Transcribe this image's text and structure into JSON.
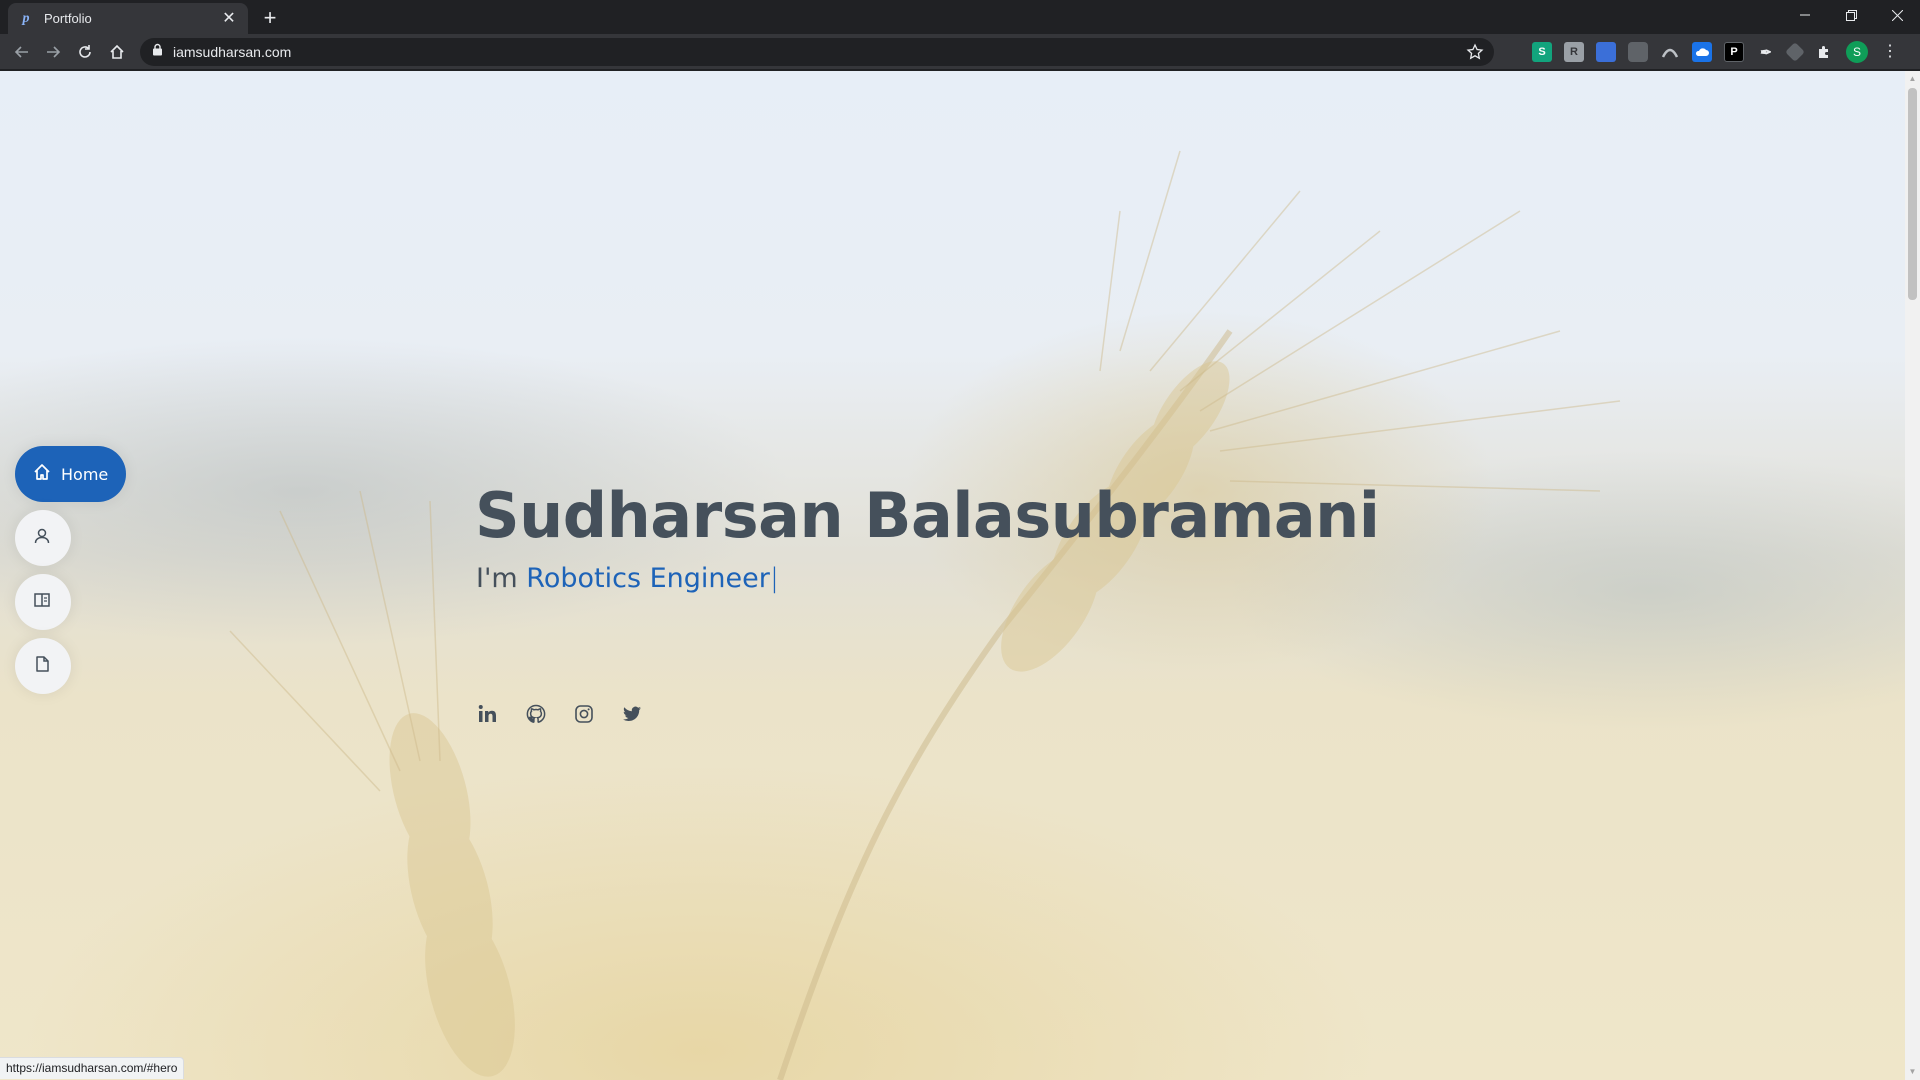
{
  "browser": {
    "tab_title": "Portfolio",
    "tab_favicon": "p",
    "url": "iamsudharsan.com",
    "status_url": "https://iamsudharsan.com/#hero",
    "profile_initial": "S",
    "extensions": [
      "S",
      "R",
      "",
      "",
      "",
      "",
      "P",
      "",
      ""
    ]
  },
  "nav": {
    "items": [
      {
        "name": "home",
        "label": "Home",
        "icon": "home-icon",
        "active": true
      },
      {
        "name": "about",
        "label": "",
        "icon": "person-icon"
      },
      {
        "name": "resume",
        "label": "",
        "icon": "book-icon"
      },
      {
        "name": "portfolio",
        "label": "",
        "icon": "file-icon"
      }
    ]
  },
  "hero": {
    "name": "Sudharsan Balasubramani",
    "prefix": "I'm ",
    "typed": "Robotics Engineer",
    "cursor": "|",
    "socials": [
      "linkedin-icon",
      "github-icon",
      "instagram-icon",
      "twitter-icon"
    ]
  },
  "colors": {
    "accent": "#1d63b8",
    "heading": "#45505b"
  }
}
